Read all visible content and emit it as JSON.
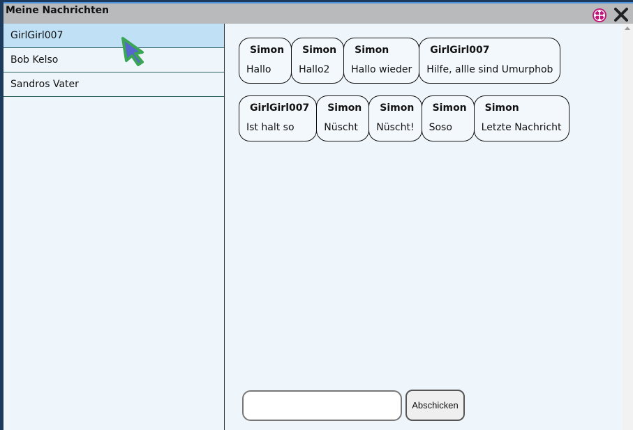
{
  "window": {
    "title": "Meine Nachrichten"
  },
  "sidebar": {
    "contacts": [
      {
        "name": "GirlGirl007",
        "selected": true
      },
      {
        "name": "Bob Kelso",
        "selected": false
      },
      {
        "name": "Sandros Vater",
        "selected": false
      }
    ]
  },
  "messages": [
    {
      "sender": "Simon",
      "text": "Hallo"
    },
    {
      "sender": "Simon",
      "text": "Hallo2"
    },
    {
      "sender": "Simon",
      "text": "Hallo wieder"
    },
    {
      "sender": "GirlGirl007",
      "text": "Hilfe, allle sind Umurphob"
    },
    {
      "sender": "GirlGirl007",
      "text": "Ist halt so"
    },
    {
      "sender": "Simon",
      "text": "Nüscht"
    },
    {
      "sender": "Simon",
      "text": "Nüscht!"
    },
    {
      "sender": "Simon",
      "text": "Soso"
    },
    {
      "sender": "Simon",
      "text": "Letzte Nachricht"
    }
  ],
  "composer": {
    "value": "",
    "send_label": "Abschicken"
  },
  "icons": {
    "move": "move-icon",
    "close": "close-icon",
    "cursor": "mouse-cursor-icon"
  },
  "colors": {
    "titlebar": "#b8babc",
    "selected_contact": "#bfe0f5",
    "background": "#eef6fb",
    "move_icon": "#c0187a",
    "cursor_fill": "#5566cc",
    "cursor_outline": "#3aa655"
  }
}
